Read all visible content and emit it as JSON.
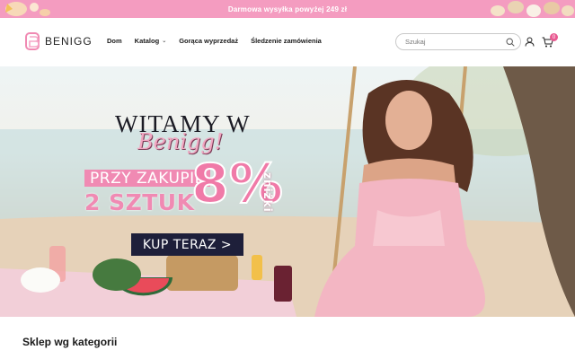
{
  "announcement": {
    "text": "Darmowa wysyłka powyżej 249 zł"
  },
  "header": {
    "logo_text": "BENIGG",
    "nav": [
      {
        "label": "Dom"
      },
      {
        "label": "Katalog"
      },
      {
        "label": "Gorąca wyprzedaż"
      },
      {
        "label": "Śledzenie zamówienia"
      }
    ],
    "search": {
      "placeholder": "Szukaj",
      "icon": "search-icon"
    },
    "account_icon": "user-icon",
    "cart": {
      "icon": "cart-icon",
      "count": "0"
    }
  },
  "hero": {
    "title": "WITAMY W",
    "brand": "Benigg!",
    "promo_line1": "PRZY ZAKUPIE",
    "promo_line2": "2 SZTUK",
    "discount_value": "8%",
    "discount_label": "zniżki",
    "cta_label": "KUP TERAZ >"
  },
  "section": {
    "title": "Sklep wg kategorii"
  },
  "colors": {
    "announcement_bg": "#f49cc0",
    "accent_pink": "#f08ab3",
    "cta_bg": "#1e1f3a",
    "badge": "#e85a91"
  }
}
